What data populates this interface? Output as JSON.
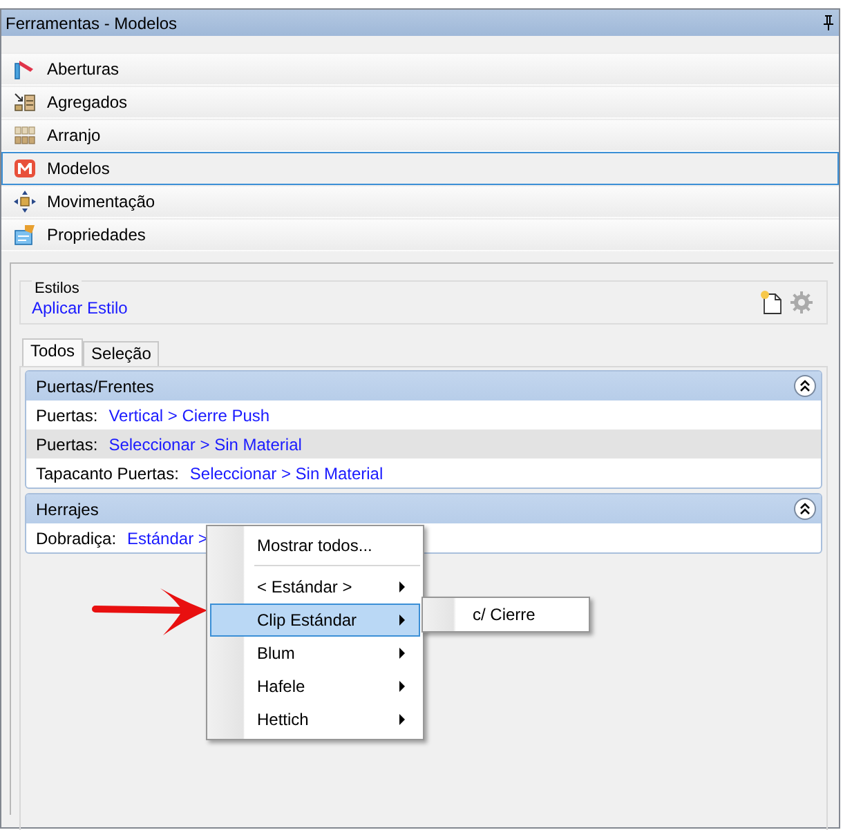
{
  "panel": {
    "title": "Ferramentas - Modelos"
  },
  "nav": [
    {
      "label": "Aberturas",
      "selected": false
    },
    {
      "label": "Agregados",
      "selected": false
    },
    {
      "label": "Arranjo",
      "selected": false
    },
    {
      "label": "Modelos",
      "selected": true
    },
    {
      "label": "Movimentação",
      "selected": false
    },
    {
      "label": "Propriedades",
      "selected": false
    }
  ],
  "styles": {
    "legend": "Estilos",
    "link": "Aplicar Estilo"
  },
  "tabs": [
    {
      "label": "Todos",
      "selected": true
    },
    {
      "label": "Seleção",
      "selected": false
    }
  ],
  "groups": [
    {
      "title": "Puertas/Frentes",
      "expanded": true,
      "rows": [
        {
          "label": "Puertas:",
          "value": "Vertical > Cierre Push",
          "selected": false
        },
        {
          "label": "Puertas:",
          "value": "Seleccionar > Sin Material",
          "selected": true
        },
        {
          "label": "Tapacanto Puertas:",
          "value": "Seleccionar > Sin Material",
          "selected": false
        }
      ]
    },
    {
      "title": "Herrajes",
      "expanded": true,
      "rows": [
        {
          "label": "Dobradiça:",
          "value": "Estándar >",
          "selected": false
        }
      ]
    }
  ],
  "context_menu": {
    "items": [
      {
        "kind": "command",
        "label": "Mostrar todos...",
        "selected": false
      },
      {
        "kind": "separator"
      },
      {
        "kind": "submenu",
        "label": "< Estándar >",
        "selected": false
      },
      {
        "kind": "submenu",
        "label": "Clip Estándar",
        "selected": true
      },
      {
        "kind": "submenu",
        "label": "Blum",
        "selected": false
      },
      {
        "kind": "submenu",
        "label": "Hafele",
        "selected": false
      },
      {
        "kind": "submenu",
        "label": "Hettich",
        "selected": false
      }
    ]
  },
  "submenu": {
    "items": [
      {
        "label": "c/ Cierre"
      }
    ]
  }
}
